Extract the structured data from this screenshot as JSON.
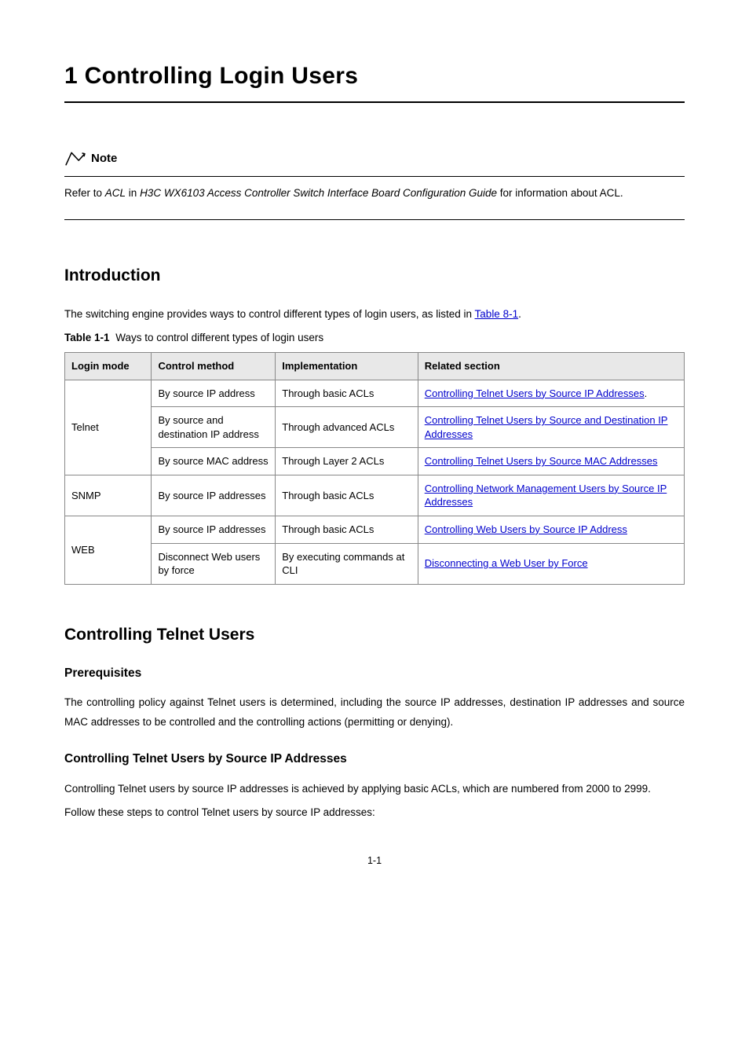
{
  "chapter": {
    "number_title": "1 Controlling Login Users"
  },
  "note": {
    "label": "Note",
    "text_prefix": "Refer to ",
    "text_italic1": "ACL",
    "text_mid": " in ",
    "text_italic2": "H3C WX6103 Access Controller Switch Interface Board Configuration Guide",
    "text_suffix": " for information about ACL."
  },
  "intro_heading": "Introduction",
  "intro_text_prefix": "The switching engine provides ways to control different types of login users, as listed in ",
  "intro_link": "Table 8-1",
  "intro_text_suffix": ".",
  "table": {
    "caption_label": "Table 1-1",
    "caption_text": "Ways to control different types of login users",
    "headers": [
      "Login mode",
      "Control method",
      "Implementation",
      "Related section"
    ],
    "rows": [
      {
        "mode": "Telnet",
        "span": 3,
        "cells": [
          {
            "method": "By source IP address",
            "impl": "Through basic ACLs",
            "related": "Controlling Telnet Users by Source IP Addresses",
            "related_suffix": "."
          },
          {
            "method": "By source and destination IP address",
            "impl": "Through advanced ACLs",
            "related": "Controlling Telnet Users by Source and Destination IP Addresses",
            "related_suffix": ""
          },
          {
            "method": "By source MAC address",
            "impl": "Through Layer 2 ACLs",
            "related": "Controlling Telnet Users by Source MAC Addresses",
            "related_suffix": ""
          }
        ]
      },
      {
        "mode": "SNMP",
        "span": 1,
        "cells": [
          {
            "method": "By source IP addresses",
            "impl": "Through basic ACLs",
            "related": "Controlling Network Management Users by Source IP Addresses",
            "related_suffix": ""
          }
        ]
      },
      {
        "mode": "WEB",
        "span": 2,
        "cells": [
          {
            "method": "By source IP addresses",
            "impl": "Through basic ACLs",
            "related": "Controlling Web Users by Source IP Address",
            "related_suffix": ""
          },
          {
            "method": "Disconnect Web users by force",
            "impl": "By executing commands at CLI",
            "related": "Disconnecting a Web User by Force",
            "related_suffix": ""
          }
        ]
      }
    ]
  },
  "section2": {
    "heading": "Controlling Telnet Users",
    "sub1_heading": "Prerequisites",
    "sub1_text": "The controlling policy against Telnet users is determined, including the source IP addresses, destination IP addresses and source MAC addresses to be controlled and the controlling actions (permitting or denying).",
    "sub2_heading": "Controlling Telnet Users by Source IP Addresses",
    "sub2_text1": "Controlling Telnet users by source IP addresses is achieved by applying basic ACLs, which are numbered from 2000 to 2999.",
    "sub2_text2": "Follow these steps to control Telnet users by source IP addresses:"
  },
  "page_number": "1-1"
}
